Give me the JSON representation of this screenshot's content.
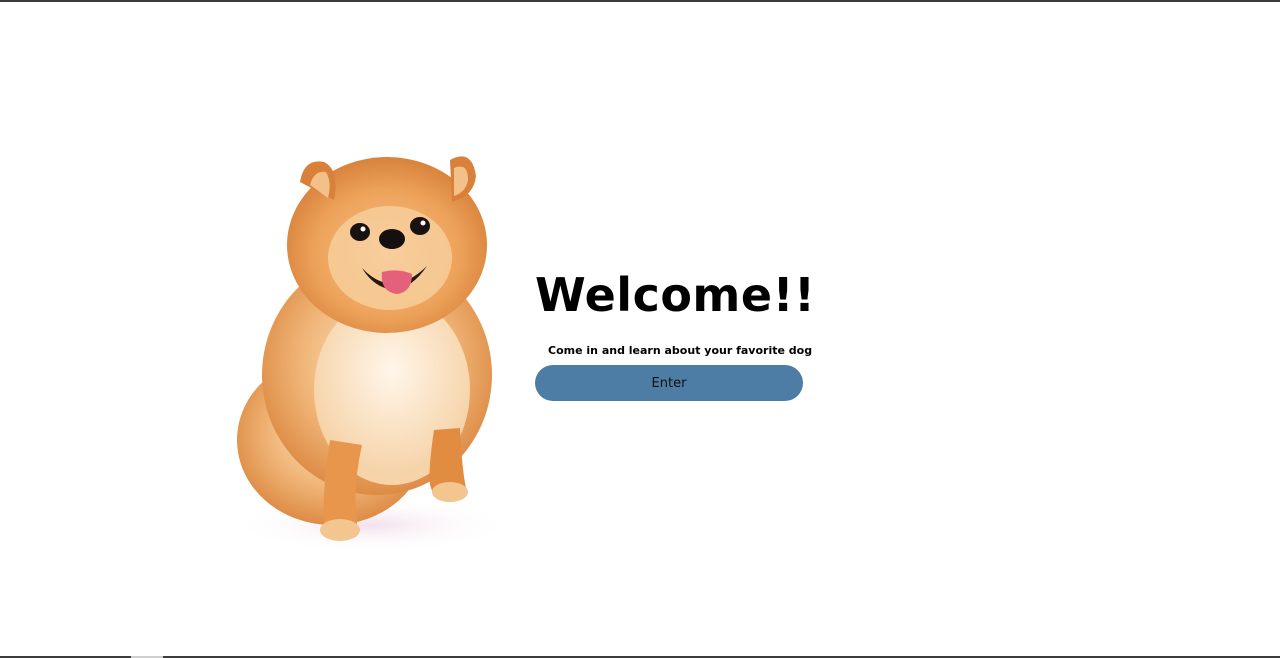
{
  "welcome": {
    "title": "Welcome!!",
    "subtitle": "Come in and learn about your favorite dog",
    "enter_label": "Enter",
    "button_color": "#4d7ca5"
  },
  "hero_image": {
    "subject": "pomeranian-dog",
    "fur_color": "#e59a4d"
  }
}
